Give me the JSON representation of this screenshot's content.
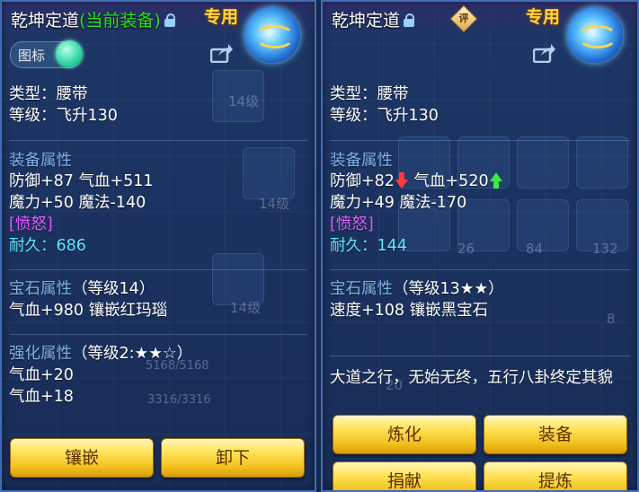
{
  "left_panel": {
    "title": "乾坤定道",
    "title_tag": "(当前装备)",
    "exclusive": "专用",
    "toggle_label": "图标",
    "type_line": "类型：腰带",
    "level_line": "等级：飞升130",
    "attr_header": "装备属性",
    "attr_line1": "防御+87 气血+511",
    "attr_line2": "魔力+50 魔法-140",
    "anger": "[愤怒]",
    "durability_label": "耐久：",
    "durability_value": "686",
    "gem_header": "宝石属性",
    "gem_level": "（等级14）",
    "gem_line": "气血+980 镶嵌红玛瑙",
    "enhance_header": "强化属性",
    "enhance_level": "（等级2:★★☆）",
    "enhance_line1": "气血+20",
    "enhance_line2": "气血+18",
    "buttons": [
      "镶嵌",
      "卸下"
    ]
  },
  "right_panel": {
    "title": "乾坤定道",
    "badge": "评",
    "exclusive": "专用",
    "type_line": "类型：腰带",
    "level_line": "等级：飞升130",
    "attr_header": "装备属性",
    "defense": "防御+82",
    "hp": "气血+520",
    "attr_line2": "魔力+49 魔法-170",
    "anger": "[愤怒]",
    "durability_label": "耐久：",
    "durability_value": "144",
    "gem_header": "宝石属性",
    "gem_level": "（等级13★★）",
    "gem_line": "速度+108 镶嵌黑宝石",
    "description": "大道之行，无始无终，五行八卦终定其貌",
    "buttons": [
      "炼化",
      "装备",
      "捐献",
      "提炼"
    ]
  },
  "background": {
    "slot_labels": [
      "14级",
      "14级",
      "14级"
    ],
    "numbers": [
      "26",
      "84",
      "132",
      "20",
      "8"
    ],
    "faint_text": [
      "5168/5168",
      "3316/3316"
    ]
  },
  "colors": {
    "equipped_tag": "#29e41a",
    "section_header": "#7fb2ea",
    "anger": "#e45cff",
    "durability": "#5fe9ff",
    "exclusive": "#ffd93b",
    "button": "#f2bf1c"
  },
  "icons": [
    "lock-icon",
    "share-icon",
    "item-belt-icon",
    "arrow-down-icon",
    "arrow-up-icon",
    "rating-badge-icon"
  ]
}
